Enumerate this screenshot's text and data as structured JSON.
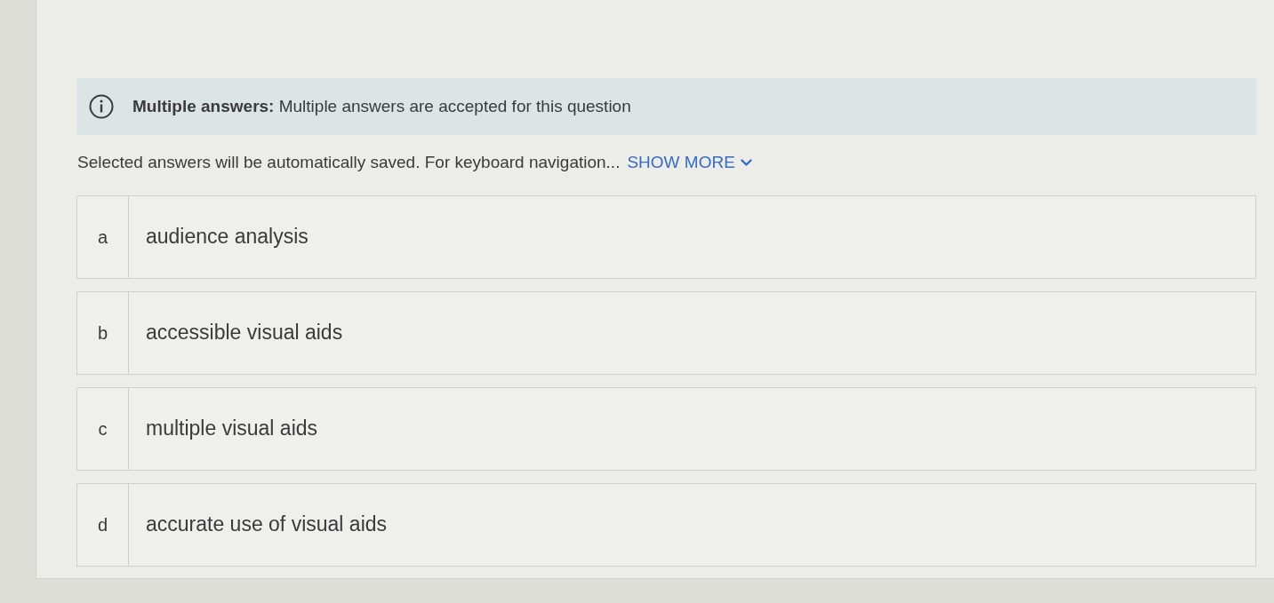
{
  "notice": {
    "text": "**Multiple answers:** Multiple answers are accepted for this question"
  },
  "instructions": {
    "text": "Selected answers will be automatically saved. For keyboard navigation...",
    "show_more": "SHOW MORE"
  },
  "options": [
    {
      "letter": "a",
      "text": "audience analysis",
      "selected": false
    },
    {
      "letter": "b",
      "text": "accessible visual aids",
      "selected": false
    },
    {
      "letter": "c",
      "text": "multiple visual aids",
      "selected": false
    },
    {
      "letter": "d",
      "text": "accurate use of visual aids",
      "selected": false
    }
  ]
}
